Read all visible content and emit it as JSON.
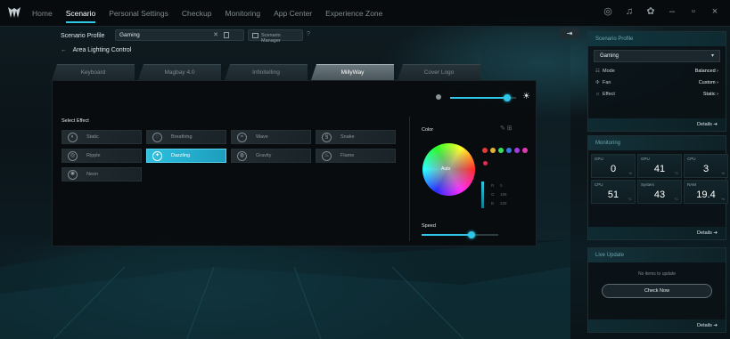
{
  "nav": {
    "items": [
      "Home",
      "Scenario",
      "Personal Settings",
      "Checkup",
      "Monitoring",
      "App Center",
      "Experience Zone"
    ],
    "active_index": 1
  },
  "window_controls": {
    "minimize": "–",
    "maximize": "▫",
    "close": "×"
  },
  "scenario": {
    "label": "Scenario Profile",
    "profile_value": "Gaming",
    "manager_label": "Scenario Manager"
  },
  "breadcrumb": {
    "back_label": "Area Lighting Control"
  },
  "tabs": [
    "Keyboard",
    "Magbay 4.0",
    "Infinitelling",
    "MillyWay",
    "Cover Logo"
  ],
  "active_tab": 3,
  "effects": {
    "title": "Select Effect",
    "items": [
      "Static",
      "Breathing",
      "Wave",
      "Snake",
      "Ripple",
      "Dazzling",
      "Gravity",
      "Flame",
      "Neon"
    ],
    "active_index": 5
  },
  "color": {
    "title": "Color",
    "wheel_label": "Auto",
    "swatches": [
      "#e03a3a",
      "#e0b23a",
      "#3ae05a",
      "#3a7ae0",
      "#a43ae0",
      "#e03ab0"
    ],
    "rgb_rows": [
      [
        "R",
        "0"
      ],
      [
        "G",
        "196"
      ],
      [
        "B",
        "229"
      ]
    ],
    "accent": "#2ec7e6"
  },
  "speed": {
    "label": "Speed",
    "level": 0.7
  },
  "brightness": {
    "level": 0.9
  },
  "sidebar": {
    "profile": {
      "header": "Scenario Profile",
      "selected": "Gaming",
      "rows": [
        {
          "icon": "mode",
          "label": "Mode",
          "value": "Balanced ›"
        },
        {
          "icon": "fan",
          "label": "Fan",
          "value": "Custom ›"
        },
        {
          "icon": "effect",
          "label": "Effect",
          "value": "Static ›"
        }
      ],
      "details": "Details ➔"
    },
    "monitoring": {
      "header": "Monitoring",
      "cells": [
        {
          "label": "GPU",
          "value": "0",
          "unit": "%"
        },
        {
          "label": "GPU",
          "value": "41",
          "unit": "°C"
        },
        {
          "label": "CPU",
          "value": "3",
          "unit": "%"
        },
        {
          "label": "CPU",
          "value": "51",
          "unit": "°C"
        },
        {
          "label": "System",
          "value": "43",
          "unit": "°C"
        },
        {
          "label": "RAM",
          "value": "19.4",
          "unit": "%"
        }
      ],
      "details": "Details ➔"
    },
    "updates": {
      "header": "Live Update",
      "message": "No items to update",
      "button": "Check Now",
      "details": "Details ➔"
    }
  }
}
